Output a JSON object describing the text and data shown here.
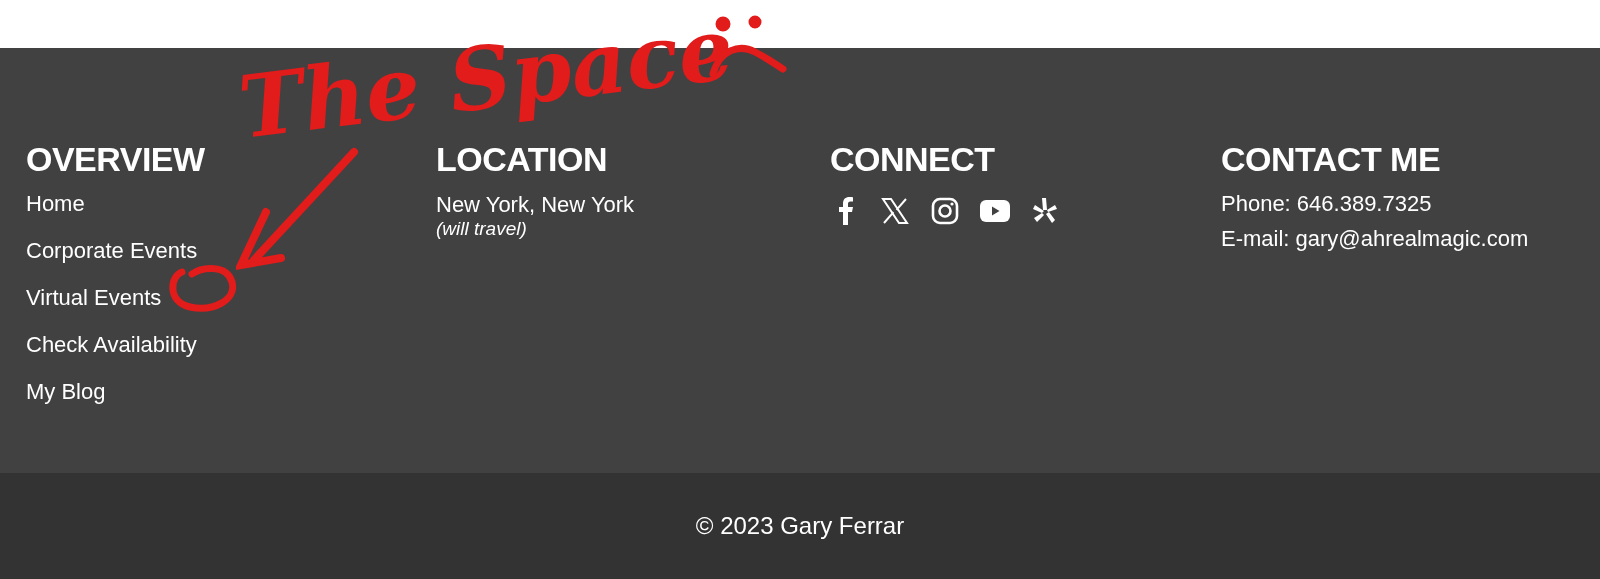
{
  "footer": {
    "columns": [
      {
        "kind": "links",
        "heading": "OVERVIEW",
        "items": [
          "Home",
          "Corporate Events",
          "Virtual Events",
          "Check Availability",
          "My Blog"
        ]
      },
      {
        "kind": "location",
        "heading": "LOCATION",
        "place": "New York, New York",
        "note": "(will travel)"
      },
      {
        "kind": "social",
        "heading": "CONNECT"
      },
      {
        "kind": "contact",
        "heading": "CONTACT ME",
        "lines": [
          "Phone: 646.389.7325",
          "E-mail: gary@ahrealmagic.com"
        ]
      }
    ]
  },
  "copyright": "© 2023 Gary Ferrar",
  "annotation": {
    "text": "The Space"
  }
}
